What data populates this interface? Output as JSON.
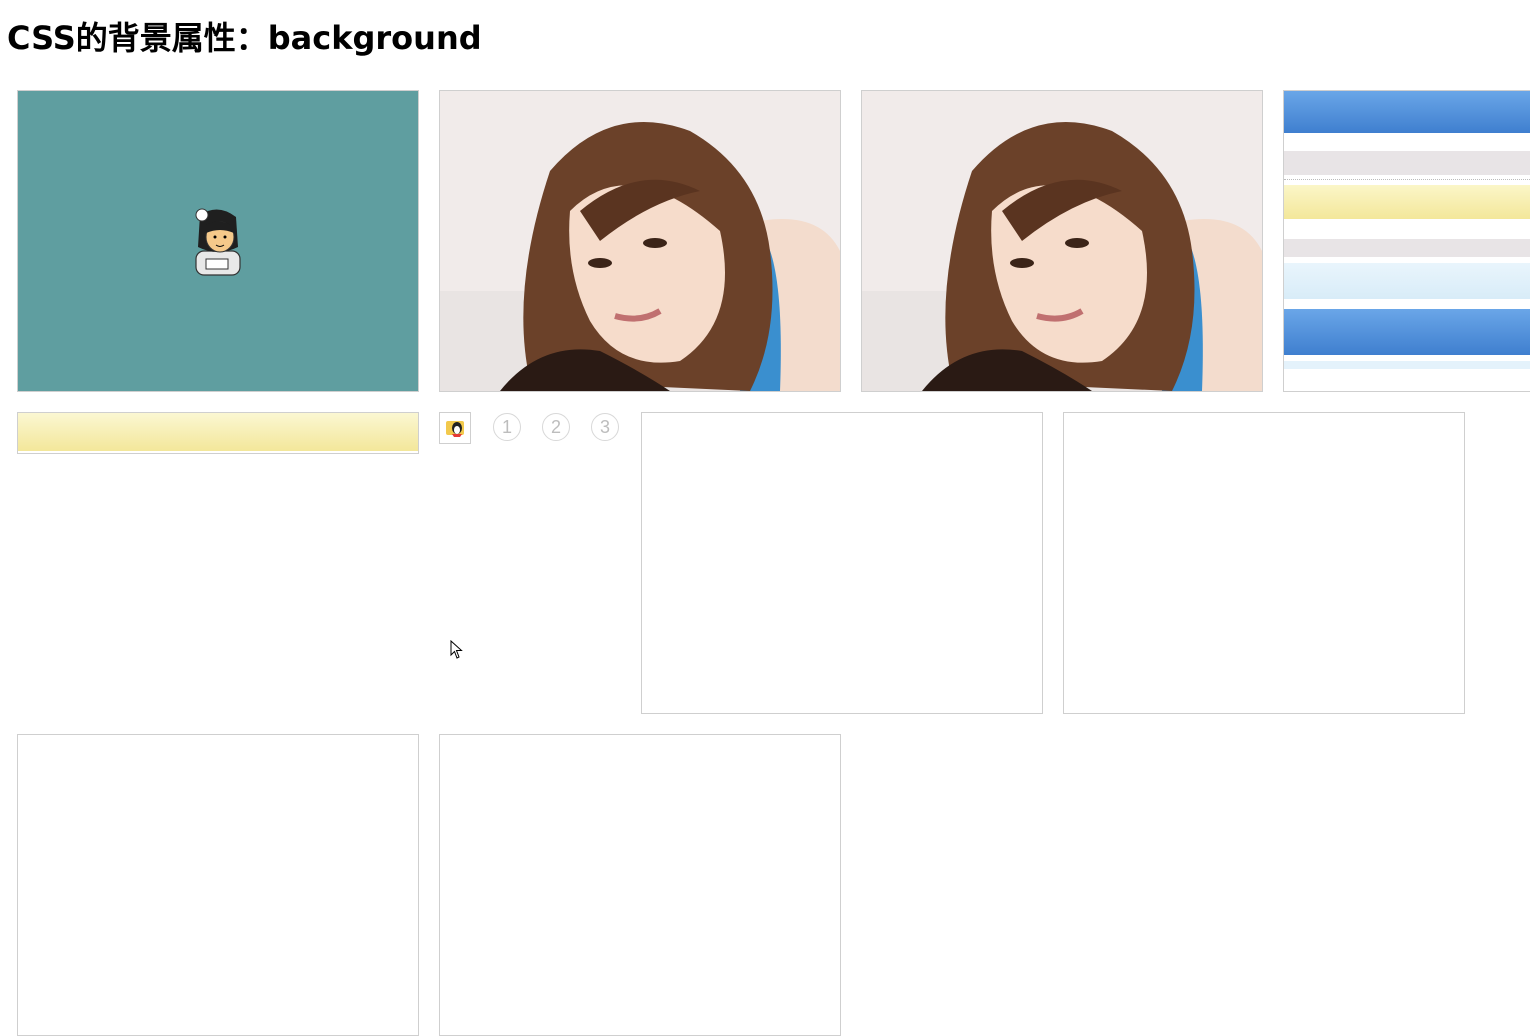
{
  "page": {
    "title": "CSS的背景属性：background"
  },
  "boxes": [
    {
      "id": "box1",
      "content": "cartoon-avatar-centered",
      "bg_color": "#5f9ea0"
    },
    {
      "id": "box2",
      "content": "portrait-photo"
    },
    {
      "id": "box3",
      "content": "portrait-photo"
    },
    {
      "id": "box4",
      "content": "stripe-sprite"
    },
    {
      "id": "box5",
      "content": "yellow-stripe"
    },
    {
      "id": "box6",
      "content": "empty"
    },
    {
      "id": "box7",
      "content": "empty"
    },
    {
      "id": "box8",
      "content": "empty"
    },
    {
      "id": "box9",
      "content": "empty"
    }
  ],
  "sprite": {
    "icon": "qq-penguin-icon",
    "numbers": [
      "1",
      "2",
      "3"
    ]
  },
  "colors": {
    "teal": "#5f9ea0",
    "blue_stripe": "#4a8bd6",
    "yellow_stripe": "#f7f0b0",
    "gray_stripe": "#e8e4e6",
    "light_blue_stripe": "#e4f2fb"
  }
}
